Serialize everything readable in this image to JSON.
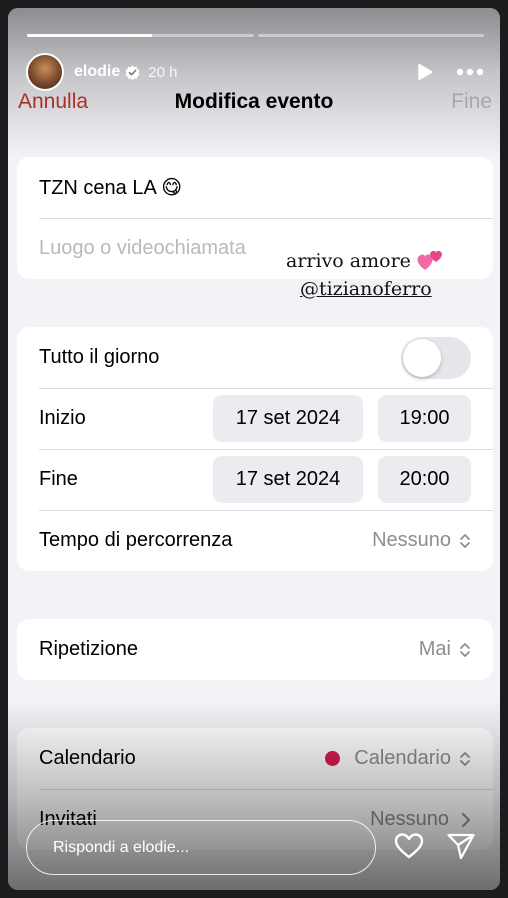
{
  "story": {
    "progress": [
      0.55,
      0
    ],
    "username": "elodie",
    "time": "20 h",
    "reply_placeholder": "Rispondi a elodie..."
  },
  "nav": {
    "cancel": "Annulla",
    "title": "Modifica evento",
    "done": "Fine"
  },
  "event": {
    "title": "TZN cena LA 😋",
    "location_placeholder": "Luogo o videochiamata"
  },
  "timing": {
    "all_day_label": "Tutto il giorno",
    "all_day_on": false,
    "start_label": "Inizio",
    "start_date": "17 set 2024",
    "start_time": "19:00",
    "end_label": "Fine",
    "end_date": "17 set 2024",
    "end_time": "20:00",
    "travel_label": "Tempo di percorrenza",
    "travel_value": "Nessuno"
  },
  "repeat": {
    "label": "Ripetizione",
    "value": "Mai"
  },
  "calendar": {
    "label": "Calendario",
    "value": "Calendario",
    "color": "#d81b4f",
    "invitees_label": "Invitati",
    "invitees_value": "Nessuno"
  },
  "sticker": {
    "text": "arrivo amore",
    "mention": "@tizianoferro"
  },
  "colors": {
    "cancel": "#c0392b",
    "done_disabled": "#bfbfc4",
    "background": "#f2f2f7"
  },
  "icons": [
    "verified-badge-icon",
    "play-icon",
    "more-icon",
    "updown-chevron-icon",
    "chevron-right-icon",
    "hearts-emoji-icon",
    "heart-icon",
    "send-icon"
  ]
}
